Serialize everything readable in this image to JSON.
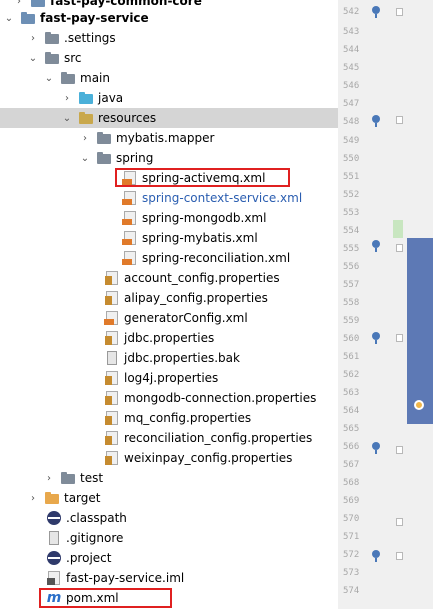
{
  "project_tree": {
    "items": [
      {
        "label": "fast-pay-common-core",
        "arrow": "›",
        "icon": "module-folder-icon",
        "bold": true
      },
      {
        "label": "fast-pay-service",
        "arrow": "⌄",
        "icon": "module-folder-icon",
        "bold": true
      },
      {
        "label": ".settings",
        "arrow": "›",
        "icon": "folder-icon"
      },
      {
        "label": "src",
        "arrow": "⌄",
        "icon": "folder-icon"
      },
      {
        "label": "main",
        "arrow": "⌄",
        "icon": "folder-icon"
      },
      {
        "label": "java",
        "arrow": "›",
        "icon": "source-folder-icon"
      },
      {
        "label": "resources",
        "arrow": "⌄",
        "icon": "resources-folder-icon",
        "selected": true
      },
      {
        "label": "mybatis.mapper",
        "arrow": "›",
        "icon": "package-folder-icon"
      },
      {
        "label": "spring",
        "arrow": "⌄",
        "icon": "package-folder-icon"
      },
      {
        "label": "spring-activemq.xml",
        "icon": "xml-file-icon",
        "highlighted": true
      },
      {
        "label": "spring-context-service.xml",
        "icon": "xml-file-icon",
        "modified": true
      },
      {
        "label": "spring-mongodb.xml",
        "icon": "xml-file-icon"
      },
      {
        "label": "spring-mybatis.xml",
        "icon": "xml-file-icon"
      },
      {
        "label": "spring-reconciliation.xml",
        "icon": "xml-file-icon"
      },
      {
        "label": "account_config.properties",
        "icon": "properties-file-icon"
      },
      {
        "label": "alipay_config.properties",
        "icon": "properties-file-icon"
      },
      {
        "label": "generatorConfig.xml",
        "icon": "xml-file-icon"
      },
      {
        "label": "jdbc.properties",
        "icon": "properties-file-icon"
      },
      {
        "label": "jdbc.properties.bak",
        "icon": "text-file-icon"
      },
      {
        "label": "log4j.properties",
        "icon": "properties-file-icon"
      },
      {
        "label": "mongodb-connection.properties",
        "icon": "properties-file-icon"
      },
      {
        "label": "mq_config.properties",
        "icon": "properties-file-icon"
      },
      {
        "label": "reconciliation_config.properties",
        "icon": "properties-file-icon"
      },
      {
        "label": "weixinpay_config.properties",
        "icon": "properties-file-icon"
      },
      {
        "label": "test",
        "arrow": "›",
        "icon": "folder-icon"
      },
      {
        "label": "target",
        "arrow": "›",
        "icon": "excluded-folder-icon"
      },
      {
        "label": ".classpath",
        "icon": "eclipse-file-icon"
      },
      {
        "label": ".gitignore",
        "icon": "text-file-icon"
      },
      {
        "label": ".project",
        "icon": "eclipse-file-icon"
      },
      {
        "label": "fast-pay-service.iml",
        "icon": "iml-file-icon"
      },
      {
        "label": "pom.xml",
        "icon": "maven-icon",
        "highlighted": true
      }
    ]
  },
  "gutter": {
    "line_numbers": [
      "542",
      "543",
      "544",
      "545",
      "546",
      "547",
      "548",
      "549",
      "550",
      "551",
      "552",
      "553",
      "554",
      "555",
      "556",
      "557",
      "558",
      "559",
      "560",
      "561",
      "562",
      "563",
      "564",
      "565",
      "566",
      "567",
      "568",
      "569",
      "570",
      "571",
      "572",
      "573",
      "574"
    ],
    "current_line": "564"
  },
  "colors": {
    "selection_bg": "#d5d5d5",
    "highlight_box": "#e02020",
    "modified_text": "#2a5db0",
    "scrollbar_thumb": "#5d79b5"
  }
}
